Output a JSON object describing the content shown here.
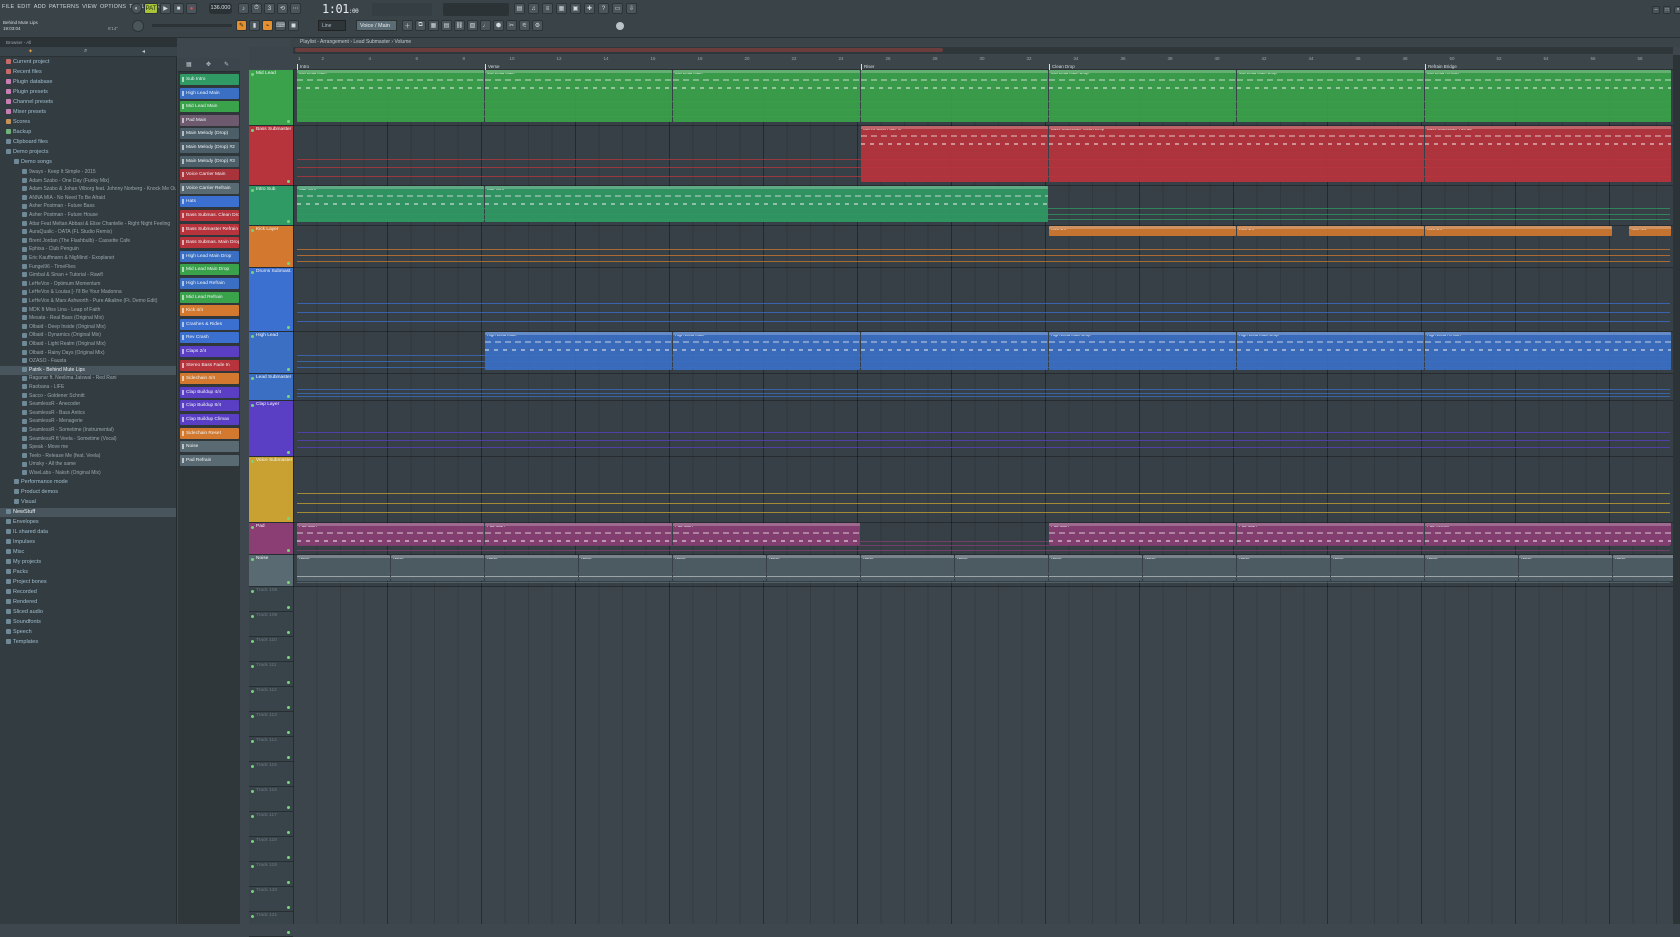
{
  "menu": [
    "FILE",
    "EDIT",
    "ADD",
    "PATTERNS",
    "VIEW",
    "OPTIONS",
    "TOOLS",
    "HELP"
  ],
  "project": {
    "title": "Behind Mute Lips",
    "time": "19:03:04",
    "hint": "8'14\""
  },
  "transport": {
    "tempo": "136.000",
    "song_pos": "1:01",
    "song_pos_small": ":00",
    "pattern": "Voice / Main",
    "snap": "Line"
  },
  "playlist_title": "Playlist - Arrangement › Lead Submaster › Volume",
  "browser": {
    "header": "Browser - All",
    "items": [
      {
        "t": "Current project",
        "k": "folder",
        "i": "red"
      },
      {
        "t": "Recent files",
        "k": "folder",
        "i": "red"
      },
      {
        "t": "Plugin database",
        "k": "folder",
        "i": "pnk"
      },
      {
        "t": "Plugin presets",
        "k": "folder",
        "i": "pnk"
      },
      {
        "t": "Channel presets",
        "k": "folder",
        "i": "pnk"
      },
      {
        "t": "Mixer presets",
        "k": "folder",
        "i": "pnk"
      },
      {
        "t": "Scores",
        "k": "folder",
        "i": "org"
      },
      {
        "t": "Backup",
        "k": "folder",
        "i": "grn"
      },
      {
        "t": "Clipboard files",
        "k": "folder",
        "i": ""
      },
      {
        "t": "Demo projects",
        "k": "folder",
        "i": ""
      },
      {
        "t": "Demo songs",
        "k": "sub",
        "i": ""
      },
      {
        "t": "9ways - Keep It Simple - 2015",
        "k": "file"
      },
      {
        "t": "Adam Szabo - One Day (Funky Mix)",
        "k": "file"
      },
      {
        "t": "Adam Szabo & Johan Vilborg feat. Johnny Norberg - Knock Me Out",
        "k": "file"
      },
      {
        "t": "ANNA MIA - No Need To Be Afraid",
        "k": "file"
      },
      {
        "t": "Asher Postman - Future Bass",
        "k": "file"
      },
      {
        "t": "Asher Postman - Future House",
        "k": "file"
      },
      {
        "t": "Attar Feat Meltan Abbasi & Elise Chantelle - Right Night Feeling",
        "k": "file"
      },
      {
        "t": "AuraQualic - DATA (FL Studio Remix)",
        "k": "file"
      },
      {
        "t": "Brent Jordan (The Flashbulb) - Cassette Cafe",
        "k": "file"
      },
      {
        "t": "Ephixa - Club Penguin",
        "k": "file"
      },
      {
        "t": "Eric Kauffmann & NigMind - Exoplanet",
        "k": "file"
      },
      {
        "t": "Fungei96 - TimeFlies",
        "k": "file"
      },
      {
        "t": "Gimbal & Sinan + Tutorial - Rawfl",
        "k": "file"
      },
      {
        "t": "LeHeVox - Optimum Momentum",
        "k": "file"
      },
      {
        "t": "LeHeVox & Louisa [- I'll Be Your Madonna",
        "k": "file"
      },
      {
        "t": "LeHeVox & Mars Ashworth - Pure Alkaline (Ft. Demo Edit)",
        "k": "file"
      },
      {
        "t": "MDK ft Miss Lina - Leap of Faith",
        "k": "file"
      },
      {
        "t": "Mesata - Real Bass (Original Mix)",
        "k": "file"
      },
      {
        "t": "Olbaid - Deep Inside (Original Mix)",
        "k": "file"
      },
      {
        "t": "Olbaid - Dynamics (Original Mix)",
        "k": "file"
      },
      {
        "t": "Olbaid - Light Realm (Original Mix)",
        "k": "file"
      },
      {
        "t": "Olbaid - Rainy Days (Original Mix)",
        "k": "file"
      },
      {
        "t": "OZASO - Fausta",
        "k": "file"
      },
      {
        "t": "Patrik - Behind Mute Lips",
        "k": "file",
        "sel": true
      },
      {
        "t": "Raganar ft. Neelima Jaiswal - Red Rani",
        "k": "file"
      },
      {
        "t": "Raobana - LIFE",
        "k": "file"
      },
      {
        "t": "Sacco - Goldener Schnitt",
        "k": "file"
      },
      {
        "t": "SeamlessR - Anecoder",
        "k": "file"
      },
      {
        "t": "SeamlessR - Bass Antics",
        "k": "file"
      },
      {
        "t": "SeamlessR - Menagerie",
        "k": "file"
      },
      {
        "t": "SeamlessR - Sometime (Instrumental)",
        "k": "file"
      },
      {
        "t": "SeamlessR ft Veela - Sometime (Vocal)",
        "k": "file"
      },
      {
        "t": "Speak - Move me",
        "k": "file"
      },
      {
        "t": "Teelo - Release Me (feat. Veela)",
        "k": "file"
      },
      {
        "t": "Umsky - All the same",
        "k": "file"
      },
      {
        "t": "WiseLabs - Naksh (Original Mix)",
        "k": "file"
      },
      {
        "t": "Performance mode",
        "k": "sub"
      },
      {
        "t": "Product demos",
        "k": "sub"
      },
      {
        "t": "Visual",
        "k": "sub"
      },
      {
        "t": "NewStuff",
        "k": "folder",
        "i": "",
        "hl": true
      },
      {
        "t": "Envelopes",
        "k": "folder",
        "i": ""
      },
      {
        "t": "IL shared data",
        "k": "folder",
        "i": ""
      },
      {
        "t": "Impulses",
        "k": "folder",
        "i": ""
      },
      {
        "t": "Misc",
        "k": "folder",
        "i": ""
      },
      {
        "t": "My projects",
        "k": "folder",
        "i": ""
      },
      {
        "t": "Packs",
        "k": "folder",
        "i": ""
      },
      {
        "t": "Project bones",
        "k": "folder",
        "i": ""
      },
      {
        "t": "Recorded",
        "k": "folder",
        "i": ""
      },
      {
        "t": "Rendered",
        "k": "folder",
        "i": ""
      },
      {
        "t": "Sliced audio",
        "k": "folder",
        "i": ""
      },
      {
        "t": "Soundfonts",
        "k": "folder",
        "i": ""
      },
      {
        "t": "Speech",
        "k": "folder",
        "i": ""
      },
      {
        "t": "Templates",
        "k": "folder",
        "i": ""
      }
    ]
  },
  "channels": [
    {
      "n": "Sub Intro",
      "c": "#2f9a63"
    },
    {
      "n": "High Lead Main",
      "c": "#3a6fc4"
    },
    {
      "n": "Mid Lead Main",
      "c": "#3aa24a"
    },
    {
      "n": "Pad Main",
      "c": "#6e5a6e"
    },
    {
      "n": "Main Melody (Drop)",
      "c": "#4c5e68"
    },
    {
      "n": "Main Melody (Drop) #2",
      "c": "#4c5e68"
    },
    {
      "n": "Main Melody (Drop) #3",
      "c": "#4c5e68"
    },
    {
      "n": "Voice Carrier Main",
      "c": "#a8333a"
    },
    {
      "n": "Voice Carrier Refrain",
      "c": "#5a6a72"
    },
    {
      "n": "Hats",
      "c": "#3b6fd0"
    },
    {
      "n": "Bass Submas. Clean Drop",
      "c": "#b8343d"
    },
    {
      "n": "Bass Submaster Refrain",
      "c": "#b8343d"
    },
    {
      "n": "Bass Submas. Main Drop",
      "c": "#b8343d"
    },
    {
      "n": "High Lead Main Drop",
      "c": "#3a6fc4"
    },
    {
      "n": "Mid Lead Main Drop",
      "c": "#3aa24a"
    },
    {
      "n": "High Lead Refrain",
      "c": "#3a6fc4"
    },
    {
      "n": "Mid Lead Refrain",
      "c": "#3aa24a"
    },
    {
      "n": "Kick 4/4",
      "c": "#d2782f"
    },
    {
      "n": "Crashes & Rides",
      "c": "#3b6fd0"
    },
    {
      "n": "Rev Crash",
      "c": "#3b6fd0"
    },
    {
      "n": "Claps 2/4",
      "c": "#5a3fc4"
    },
    {
      "n": "Stereo Bass Fade In",
      "c": "#b8343d"
    },
    {
      "n": "Sidechain 4/4",
      "c": "#d2782f"
    },
    {
      "n": "Clap Buildup 4/4",
      "c": "#5a3fc4"
    },
    {
      "n": "Clap Buildup 8/4",
      "c": "#5a3fc4"
    },
    {
      "n": "Clap Buildup Climax",
      "c": "#5a3fc4"
    },
    {
      "n": "Sidechain Reset",
      "c": "#d2782f"
    },
    {
      "n": "Noise",
      "c": "#5a6a72"
    },
    {
      "n": "Pad Refrain",
      "c": "#5a6a72"
    }
  ],
  "markers": [
    {
      "t": "Intro",
      "b": 1
    },
    {
      "t": "Verse",
      "b": 9
    },
    {
      "t": "Riser",
      "b": 25
    },
    {
      "t": "Clean Drop",
      "b": 33
    },
    {
      "t": "Refrain Bridge",
      "b": 49
    }
  ],
  "tracks": [
    {
      "n": "Mid Lead",
      "c": "#3aa24a",
      "h": 56
    },
    {
      "n": "Bass Submaster",
      "c": "#b8343d",
      "h": 60
    },
    {
      "n": "Intro Sub",
      "c": "#2f9a63",
      "h": 40
    },
    {
      "n": "Kick Layer",
      "c": "#d2782f",
      "h": 42
    },
    {
      "n": "Drums Submast.",
      "c": "#3b6fd0",
      "h": 64
    },
    {
      "n": "High Lead",
      "c": "#3a6fc4",
      "h": 42
    },
    {
      "n": "Lead Submaster",
      "c": "#3a6fc4",
      "h": 27
    },
    {
      "n": "Clap Layer",
      "c": "#5a3fc4",
      "h": 56
    },
    {
      "n": "Voice Submaster",
      "c": "#c9a132",
      "h": 66
    },
    {
      "n": "Pad",
      "c": "#8a3e74",
      "h": 32
    },
    {
      "n": "Noise",
      "c": "#5a6a72",
      "h": 32
    },
    {
      "n": "Track 108",
      "c": "",
      "h": 25
    },
    {
      "n": "Track 109",
      "c": "",
      "h": 25
    },
    {
      "n": "Track 110",
      "c": "",
      "h": 25
    },
    {
      "n": "Track 111",
      "c": "",
      "h": 25
    },
    {
      "n": "Track 112",
      "c": "",
      "h": 25
    },
    {
      "n": "Track 113",
      "c": "",
      "h": 25
    },
    {
      "n": "Track 114",
      "c": "",
      "h": 25
    },
    {
      "n": "Track 115",
      "c": "",
      "h": 25
    },
    {
      "n": "Track 116",
      "c": "",
      "h": 25
    },
    {
      "n": "Track 117",
      "c": "",
      "h": 25
    },
    {
      "n": "Track 118",
      "c": "",
      "h": 25
    },
    {
      "n": "Track 119",
      "c": "",
      "h": 25
    },
    {
      "n": "Track 120",
      "c": "",
      "h": 25
    },
    {
      "n": "Track 121",
      "c": "",
      "h": 25
    }
  ],
  "clips": [
    {
      "t": 0,
      "l": "Mid Lead Main",
      "s": 1,
      "e": 9,
      "c": "#3aa24a"
    },
    {
      "t": 0,
      "l": "Mid Lead Main",
      "s": 9,
      "e": 17,
      "c": "#3aa24a"
    },
    {
      "t": 0,
      "l": "Mid Lead Main",
      "s": 17,
      "e": 25,
      "c": "#3aa24a"
    },
    {
      "t": 0,
      "l": "",
      "s": 25,
      "e": 33,
      "c": "#3aa24a"
    },
    {
      "t": 0,
      "l": "Mid Lead Main Drop",
      "s": 33,
      "e": 41,
      "c": "#3aa24a"
    },
    {
      "t": 0,
      "l": "Mid Lead Main Drop",
      "s": 41,
      "e": 49,
      "c": "#3aa24a"
    },
    {
      "t": 0,
      "l": "Mid Lead Refrain",
      "s": 49,
      "e": 59.5,
      "c": "#3aa24a"
    },
    {
      "t": 1,
      "l": "Stereo Bass Fade In",
      "s": 25,
      "e": 33,
      "c": "#b8343d"
    },
    {
      "t": 1,
      "l": "Bass Submaster Clean Drop",
      "s": 33,
      "e": 49,
      "c": "#b8343d"
    },
    {
      "t": 1,
      "l": "Bass Submaster Refrain",
      "s": 49,
      "e": 59.5,
      "c": "#b8343d"
    },
    {
      "t": 2,
      "l": "Sub Intro",
      "s": 1,
      "e": 9,
      "c": "#2f9a63"
    },
    {
      "t": 2,
      "l": "Sub Intro",
      "s": 9,
      "e": 33,
      "c": "#2f9a63"
    },
    {
      "t": 3,
      "l": "Kick 4/4",
      "s": 33,
      "e": 41,
      "c": "#d2782f"
    },
    {
      "t": 3,
      "l": "Kick 4/4",
      "s": 41,
      "e": 49,
      "c": "#d2782f"
    },
    {
      "t": 3,
      "l": "Kick 4/4",
      "s": 49,
      "e": 57,
      "c": "#d2782f"
    },
    {
      "t": 3,
      "l": "Kick 4/4",
      "s": 57.7,
      "e": 59.5,
      "c": "#d2782f"
    },
    {
      "t": 5,
      "l": "High Lead Main",
      "s": 9,
      "e": 17,
      "c": "#3a6fc4"
    },
    {
      "t": 5,
      "l": "High Lead Main",
      "s": 17,
      "e": 25,
      "c": "#3a6fc4"
    },
    {
      "t": 5,
      "l": "",
      "s": 25,
      "e": 33,
      "c": "#3a6fc4"
    },
    {
      "t": 5,
      "l": "High Lead Main Drop",
      "s": 33,
      "e": 41,
      "c": "#3a6fc4"
    },
    {
      "t": 5,
      "l": "High Lead Main Drop",
      "s": 41,
      "e": 49,
      "c": "#3a6fc4"
    },
    {
      "t": 5,
      "l": "High Lead Refrain",
      "s": 49,
      "e": 59.5,
      "c": "#3a6fc4"
    },
    {
      "t": 9,
      "l": "Pad Main",
      "s": 1,
      "e": 9,
      "c": "#8a3e74"
    },
    {
      "t": 9,
      "l": "Pad Main",
      "s": 9,
      "e": 17,
      "c": "#8a3e74"
    },
    {
      "t": 9,
      "l": "Pad Main",
      "s": 17,
      "e": 25,
      "c": "#8a3e74"
    },
    {
      "t": 9,
      "l": "Pad Main",
      "s": 33,
      "e": 41,
      "c": "#8a3e74"
    },
    {
      "t": 9,
      "l": "Pad Main",
      "s": 41,
      "e": 49,
      "c": "#8a3e74"
    },
    {
      "t": 9,
      "l": "Pad Refrain",
      "s": 49,
      "e": 59.5,
      "c": "#8a3e74"
    }
  ],
  "noise_label": "Noise",
  "icons": {
    "play": "play-icon",
    "stop": "stop-icon",
    "record": "record-icon",
    "pattern": "pattern-icon"
  }
}
